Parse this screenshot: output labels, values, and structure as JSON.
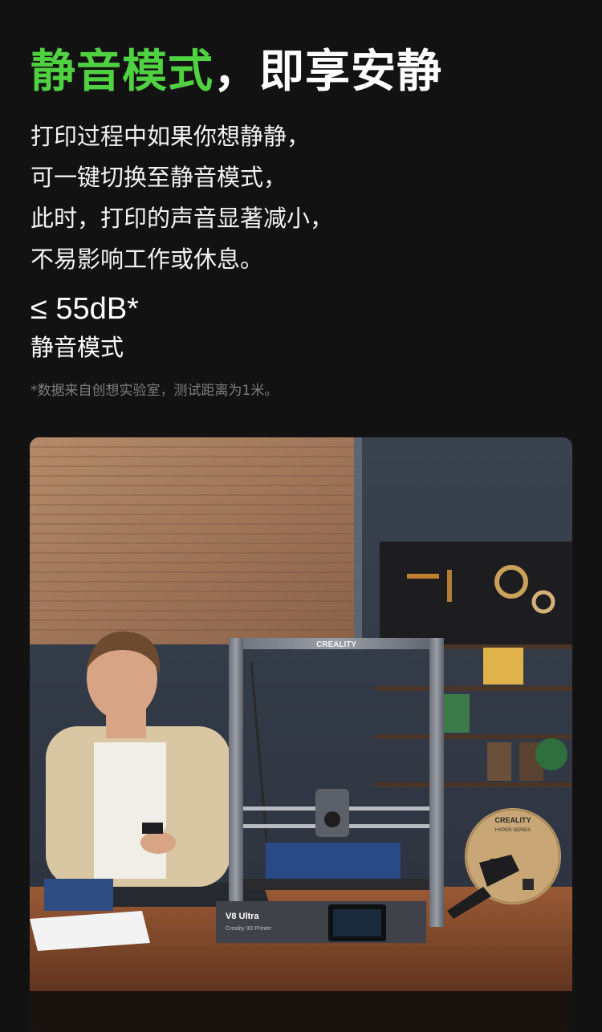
{
  "headline": {
    "accent_text": "静音模式",
    "rest_text": "，即享安静"
  },
  "description": {
    "lines": [
      "打印过程中如果你想静静，",
      "可一键切换至静音模式，",
      "此时，打印的声音显著减小，",
      "不易影响工作或休息。"
    ]
  },
  "stat": {
    "value": "≤ 55dB*",
    "label": "静音模式"
  },
  "footnote": "*数据来自创想实验室，测试距离为1米。",
  "photo": {
    "printer_brand": "CREALITY",
    "printer_model": "V8 Ultra",
    "printer_subtitle": "Creality 3D Printer",
    "spool_brand": "CREALITY",
    "spool_series": "HYPER SERIES"
  },
  "colors": {
    "background": "#121212",
    "accent_green": "#4fd141",
    "footnote_gray": "#7d7d7d"
  }
}
